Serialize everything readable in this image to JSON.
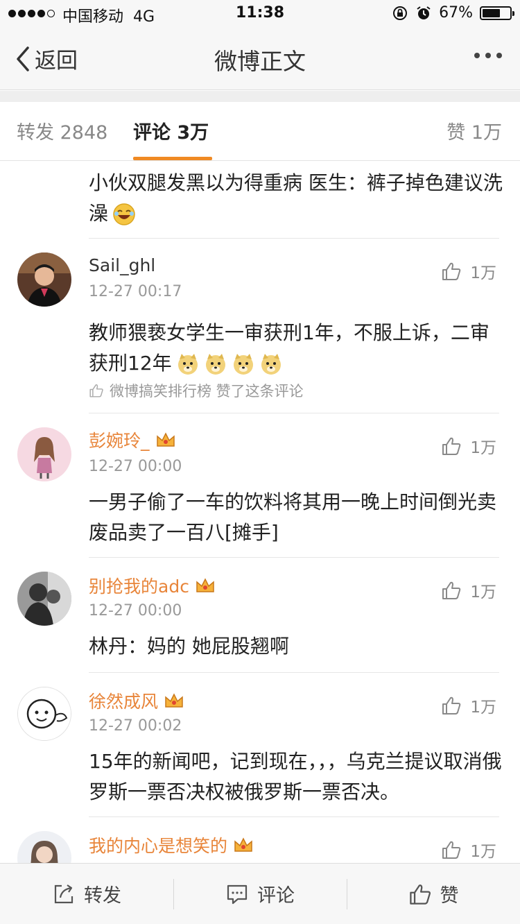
{
  "status_bar": {
    "carrier": "中国移动",
    "network": "4G",
    "time": "11:38",
    "battery": "67%",
    "battery_level": 0.67
  },
  "nav": {
    "back_label": "返回",
    "title": "微博正文"
  },
  "tabs": {
    "repost": "转发 2848",
    "comment": "评论 3万",
    "like": "赞 1万"
  },
  "comments": [
    {
      "text": "小伙双腿发黑以为得重病  医生：裤子掉色建议洗澡"
    },
    {
      "username": "Sail_ghl",
      "time": "12-27 00:17",
      "likes": "1万",
      "text": "教师猥亵女学生一审获刑1年，不服上诉，二审获刑12年",
      "liked_note": "微博搞笑排行榜 赞了这条评论"
    },
    {
      "username": "彭婉玲_",
      "time": "12-27 00:00",
      "likes": "1万",
      "text": "一男子偷了一车的饮料将其用一晚上时间倒光卖废品卖了一百八[摊手]"
    },
    {
      "username": "别抢我的adc",
      "time": "12-27 00:00",
      "likes": "1万",
      "text": "林丹：妈的 她屁股翘啊"
    },
    {
      "username": "徐然成风",
      "time": "12-27 00:02",
      "likes": "1万",
      "text": "15年的新闻吧，记到现在，，，乌克兰提议取消俄罗斯一票否决权被俄罗斯一票否决。"
    },
    {
      "username": "我的内心是想笑的",
      "likes": "1万"
    }
  ],
  "bottom_bar": {
    "repost": "转发",
    "comment": "评论",
    "like": "赞"
  },
  "colors": {
    "accent": "#f08a24",
    "vip_name": "#e8853a",
    "muted": "#999999"
  }
}
